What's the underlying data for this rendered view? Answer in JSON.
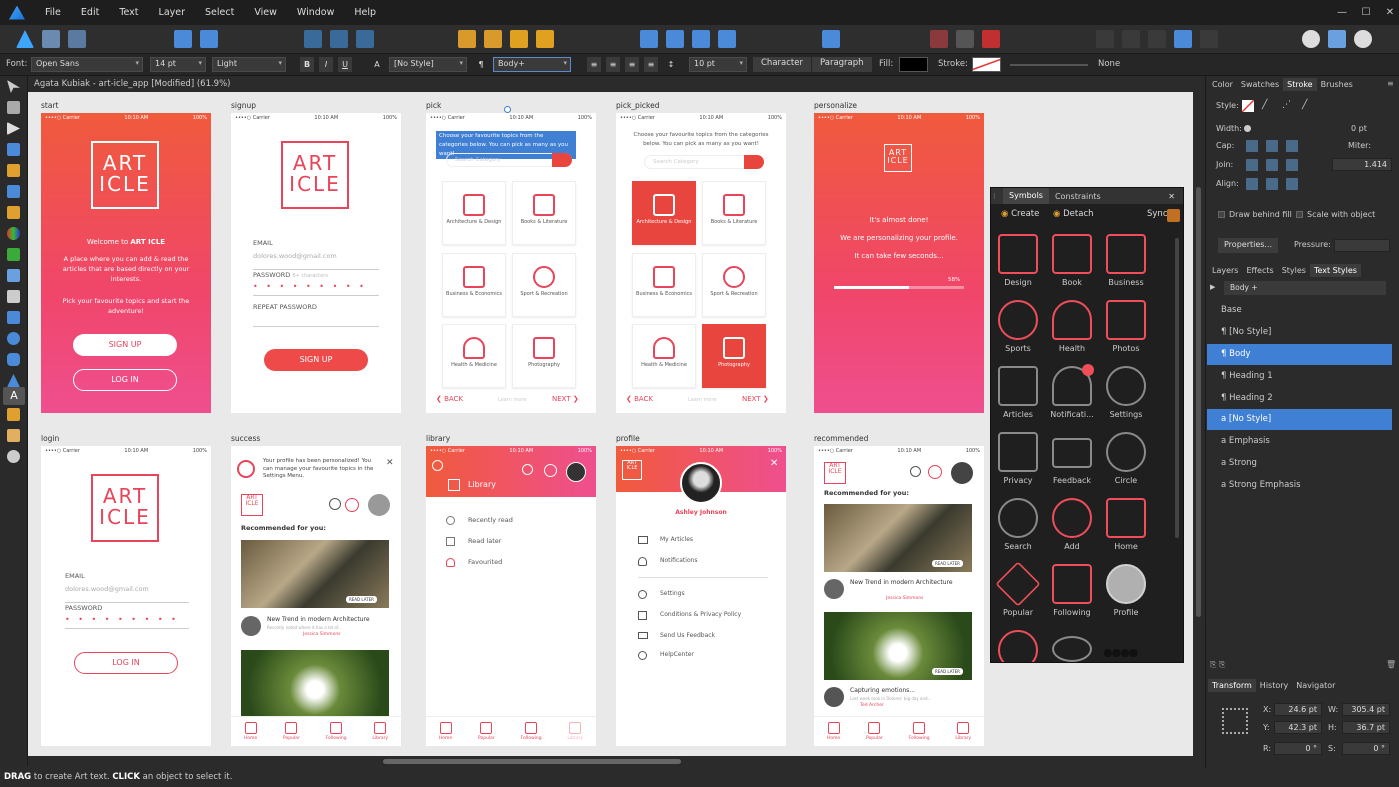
{
  "menubar": {
    "items": [
      "File",
      "Edit",
      "Text",
      "Layer",
      "Select",
      "View",
      "Window",
      "Help"
    ],
    "window_controls": [
      "minimize",
      "maximize",
      "close"
    ]
  },
  "context_toolbar": {
    "font_label": "Font:",
    "font_family": "Open Sans",
    "font_size": "14 pt",
    "font_weight": "Light",
    "bold": "B",
    "italic": "I",
    "underline": "U",
    "char_style": "[No Style]",
    "para_style": "Body+",
    "leading": "10 pt",
    "character_btn": "Character",
    "paragraph_btn": "Paragraph",
    "fill_label": "Fill:",
    "stroke_label": "Stroke:",
    "none_label": "None"
  },
  "document": {
    "title": "Agata Kubiak - art-icle_app [Modified] (61.9%)"
  },
  "status": {
    "drag": "DRAG",
    "drag_text": " to create Art text. ",
    "click": "CLICK",
    "click_text": " an object to select it."
  },
  "artboards": {
    "start": {
      "label": "start",
      "carrier": "••••○ Carrier",
      "time": "10:10 AM",
      "battery": "100%",
      "logo_line1": "ART",
      "logo_line2": "ICLE",
      "welcome_pre": "Welcome to ",
      "welcome_brand": "ART ICLE",
      "intro": "A place where you can add & read the articles that are based directly on your interests.",
      "pick": "Pick your favourite topics and start the adventure!",
      "signup": "SIGN UP",
      "login": "LOG IN"
    },
    "signup": {
      "label": "signup",
      "carrier": "••••○ Carrier",
      "time": "10:10 AM",
      "battery": "100%",
      "logo_line1": "ART",
      "logo_line2": "ICLE",
      "email_label": "EMAIL",
      "email_value": "dolores.wood@gmail.com",
      "password_label": "PASSWORD",
      "password_hint": "6+ characters",
      "password_dots": "• • • • • • • • •",
      "repeat_label": "REPEAT PASSWORD",
      "signup_btn": "SIGN UP"
    },
    "pick": {
      "label": "pick",
      "carrier": "••••○ Carrier",
      "time": "10:10 AM",
      "battery": "100%",
      "intro": "Choose your favourite topics from the categories below. You can pick as many as you want!",
      "search_placeholder": "Search Category",
      "tiles": [
        "Architecture & Design",
        "Books & Literature",
        "Business & Economics",
        "Sport & Recreation",
        "Health & Medicine",
        "Photography"
      ],
      "back": "❮ BACK",
      "learn": "Learn more",
      "next": "NEXT ❯"
    },
    "pick_picked": {
      "label": "pick_picked",
      "carrier": "••••○ Carrier",
      "time": "10:10 AM",
      "battery": "100%",
      "intro": "Choose your favourite topics from the categories below. You can pick as many as you want!",
      "search_placeholder": "Search Category",
      "tiles": [
        "Architecture & Design",
        "Books & Literature",
        "Business & Economics",
        "Sport & Recreation",
        "Health & Medicine",
        "Photography"
      ],
      "back": "❮ BACK",
      "learn": "Learn more",
      "next": "NEXT ❯"
    },
    "personalize": {
      "label": "personalize",
      "carrier": "••••○ Carrier",
      "time": "10:10 AM",
      "battery": "100%",
      "logo_line1": "ART",
      "logo_line2": "ICLE",
      "line1": "It's almost done!",
      "line2": "We are personalizing your profile.",
      "line3": "It can take few seconds...",
      "progress_label": "58%",
      "progress": 0.58
    },
    "login": {
      "label": "login",
      "carrier": "••••○ Carrier",
      "time": "10:10 AM",
      "battery": "100%",
      "logo_line1": "ART",
      "logo_line2": "ICLE",
      "email_label": "EMAIL",
      "email_value": "dolores.wood@gmail.com",
      "password_label": "PASSWORD",
      "password_dots": "• • • • • • • • •",
      "login_btn": "LOG IN"
    },
    "success": {
      "label": "success",
      "msg": "Your profile has been personalized! You can manage your favourite topics in the Settings Menu.",
      "recommended": "Recommended for you:",
      "article_title": "New Trend in modern Architecture",
      "article_sub": "Recently noted where it has a lot of...",
      "author": "Jessica Simmons",
      "read_later": "READ LATER",
      "tabs": [
        "Home",
        "Popular",
        "Following",
        "Library"
      ]
    },
    "library": {
      "label": "library",
      "carrier": "••••○ Carrier",
      "time": "10:10 AM",
      "battery": "100%",
      "title": "Library",
      "items": [
        "Recently read",
        "Read later",
        "Favourited"
      ],
      "tabs": [
        "Home",
        "Popular",
        "Following",
        "Library"
      ]
    },
    "profile": {
      "label": "profile",
      "carrier": "••••○ Carrier",
      "time": "10:10 AM",
      "battery": "100%",
      "name": "Ashley Johnson",
      "items": [
        "My Articles",
        "Notifications",
        "Settings",
        "Conditions & Privacy Policy",
        "Send Us Feedback",
        "HelpCenter"
      ]
    },
    "recommended": {
      "label": "recommended",
      "carrier": "••••○ Carrier",
      "time": "10:10 AM",
      "battery": "100%",
      "heading": "Recommended for you:",
      "article1_title": "New Trend in modern Architecture",
      "article1_author": "Jessica Simmons",
      "article2_title": "Capturing emotions...",
      "article2_sub": "Last week took in Dolores' big day and...",
      "article2_author": "Ted Archer",
      "read_later": "READ LATER",
      "tabs": [
        "Home",
        "Popular",
        "Following",
        "Library"
      ]
    }
  },
  "symbols_panel": {
    "tabs": [
      "Symbols",
      "Constraints"
    ],
    "create": "Create",
    "detach": "Detach",
    "sync": "Sync:",
    "items": [
      "Design",
      "Book",
      "Business",
      "Sports",
      "Health",
      "Photos",
      "Articles",
      "Notificati...",
      "Settings",
      "Privacy",
      "Feedback",
      "Circle",
      "Search",
      "Add",
      "Home",
      "Popular",
      "Following",
      "Profile"
    ]
  },
  "right_panel": {
    "top_tabs": [
      "Color",
      "Swatches",
      "Stroke",
      "Brushes"
    ],
    "style_label": "Style:",
    "width_label": "Width:",
    "width_value": "0 pt",
    "cap_label": "Cap:",
    "miter_label": "Miter:",
    "join_label": "Join:",
    "miter_value": "1.414",
    "align_label": "Align:",
    "draw_behind": "Draw behind fill",
    "scale_with": "Scale with object",
    "properties_btn": "Properties...",
    "pressure_label": "Pressure:",
    "mid_tabs": [
      "Layers",
      "Effects",
      "Styles",
      "Text Styles"
    ],
    "style_dropdown": "Body +",
    "text_styles": [
      "Base",
      "[No Style]",
      "Body",
      "Heading 1",
      "Heading 2",
      "[No Style]",
      "Emphasis",
      "Strong",
      "Strong Emphasis"
    ],
    "bottom_tabs": [
      "Transform",
      "History",
      "Navigator"
    ],
    "x_label": "X:",
    "x_value": "24.6 pt",
    "y_label": "Y:",
    "y_value": "42.3 pt",
    "w_label": "W:",
    "w_value": "305.4 pt",
    "h_label": "H:",
    "h_value": "36.7 pt",
    "r_label": "R:",
    "r_value": "0 °",
    "s_label": "S:",
    "s_value": "0 °"
  },
  "colors": {
    "accent_red": "#e8445a",
    "gradient_top": "#f05a3c",
    "gradient_bottom": "#ef4f8f",
    "selection_blue": "#3f7fd4"
  }
}
